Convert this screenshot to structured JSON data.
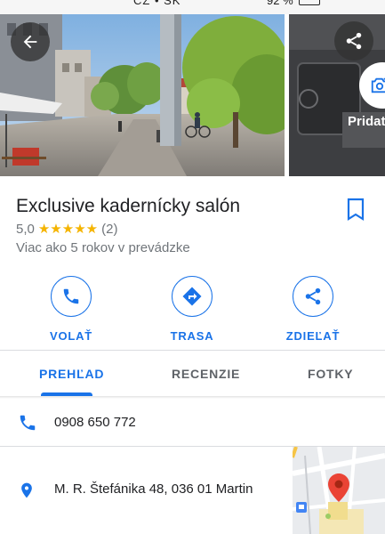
{
  "status_bar": {
    "left_text": "CZ • SK",
    "right_text": "92 %"
  },
  "photos": {
    "add_photo_label": "Pridať"
  },
  "place": {
    "name": "Exclusive kadernícky salón",
    "rating": "5,0",
    "stars": "★★★★★",
    "review_count": "(2)",
    "years": "Viac ako 5 rokov v prevádzke"
  },
  "actions": [
    {
      "label": "VOLAŤ",
      "icon": "phone-icon"
    },
    {
      "label": "TRASA",
      "icon": "directions-icon"
    },
    {
      "label": "ZDIEĽAŤ",
      "icon": "share-icon"
    }
  ],
  "tabs": [
    {
      "label": "PREHĽAD",
      "active": true
    },
    {
      "label": "RECENZIE",
      "active": false
    },
    {
      "label": "FOTKY",
      "active": false
    }
  ],
  "info": {
    "phone": "0908 650 772",
    "address": "M. R. Štefánika 48, 036 01 Martin"
  },
  "colors": {
    "accent": "#1a73e8",
    "star": "#f5b400",
    "map_pin": "#ea4335"
  }
}
